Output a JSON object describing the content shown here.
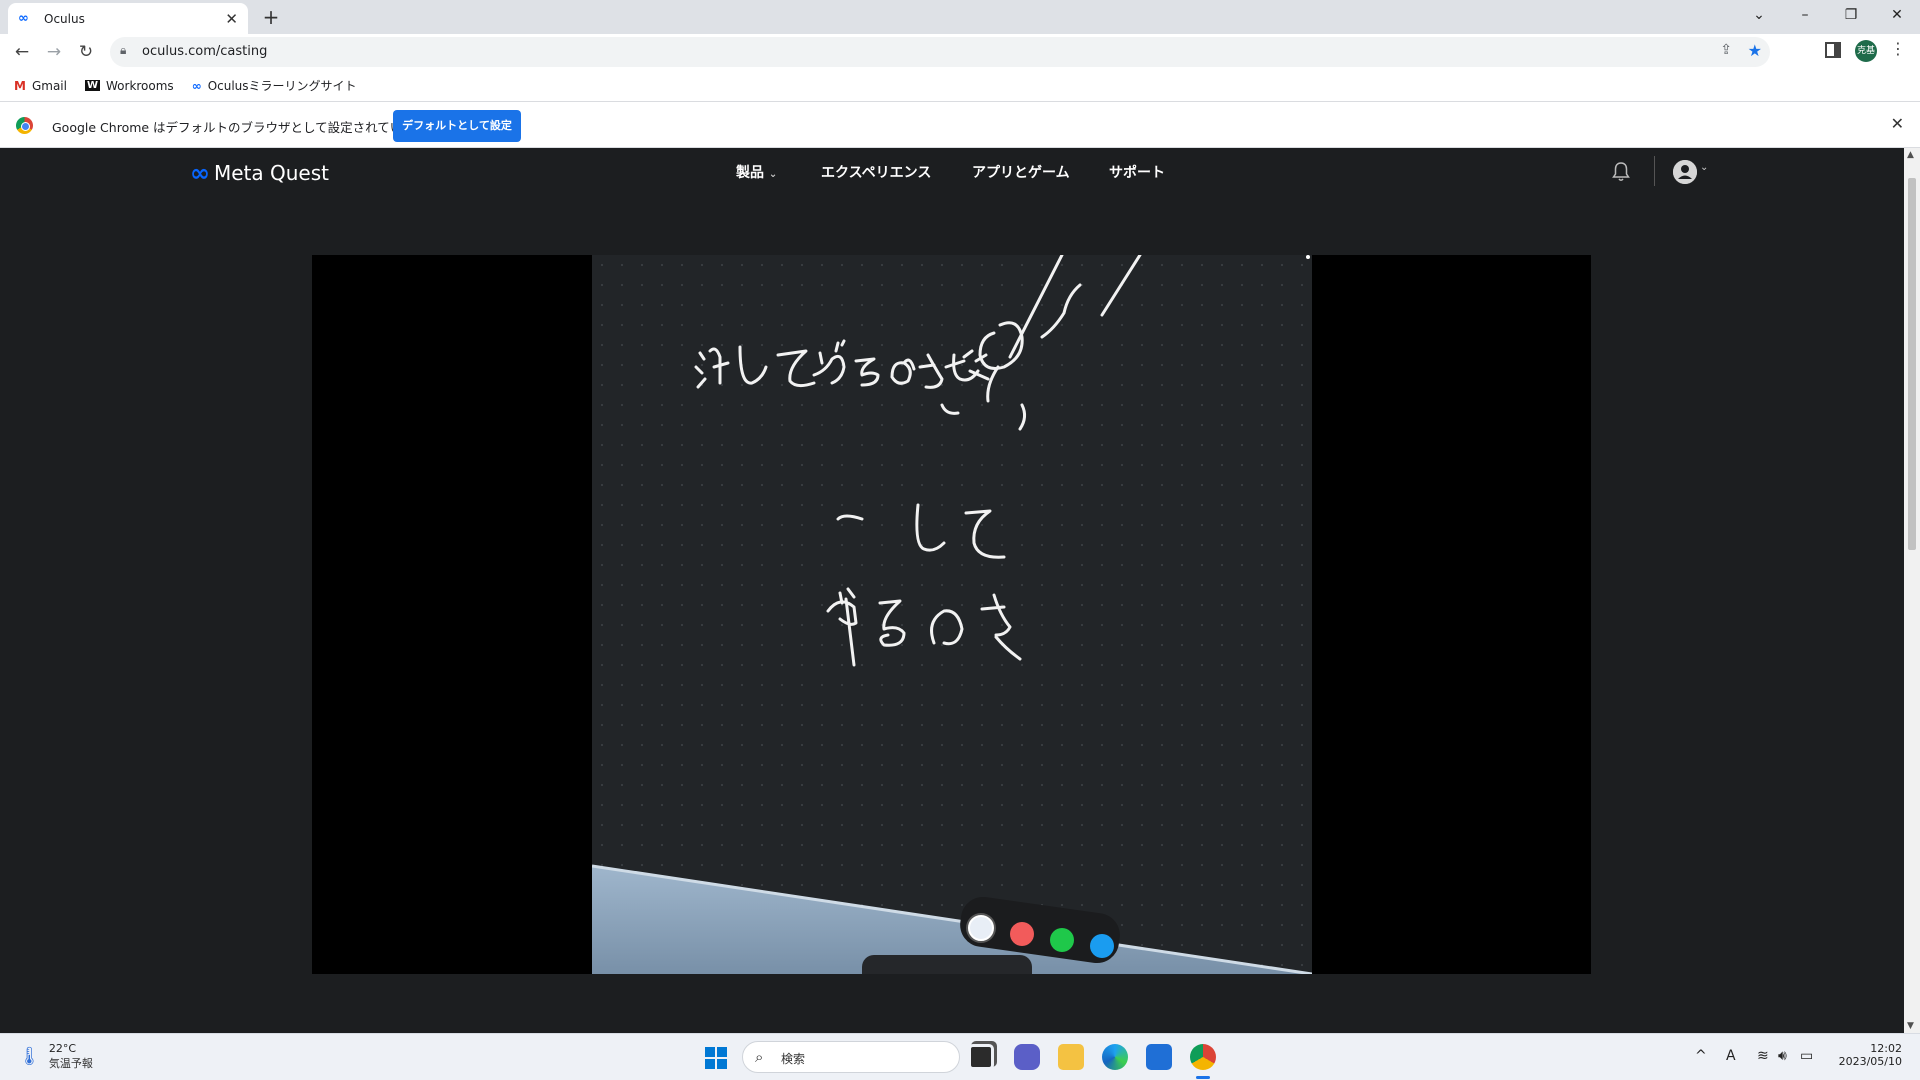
{
  "browser": {
    "tab_title": "Oculus",
    "url": "oculus.com/casting",
    "new_tab": "+",
    "profile_initials": "克基"
  },
  "bookmarks": [
    {
      "label": "Gmail",
      "icon": "gmail-icon"
    },
    {
      "label": "Workrooms",
      "icon": "workrooms-icon"
    },
    {
      "label": "Oculusミラーリングサイト",
      "icon": "meta-icon"
    }
  ],
  "infobar": {
    "message": "Google Chrome はデフォルトのブラウザとして設定されていません",
    "button": "デフォルトとして設定"
  },
  "site": {
    "logo": "Meta Quest",
    "nav": [
      "製品",
      "エクスペリエンス",
      "アプリとゲーム",
      "サポート"
    ]
  },
  "cast": {
    "palette_colors": [
      "#e8eef6",
      "#f25b5b",
      "#1fc84a",
      "#1a9cf0"
    ]
  },
  "taskbar": {
    "weather_temp": "22°C",
    "weather_label": "気温予報",
    "search_placeholder": "検索",
    "ime": "A",
    "time": "12:02",
    "date": "2023/05/10"
  },
  "colors": {
    "accent": "#1a73e8",
    "meta_blue": "#0866ff",
    "page_bg": "#1c1e20"
  }
}
